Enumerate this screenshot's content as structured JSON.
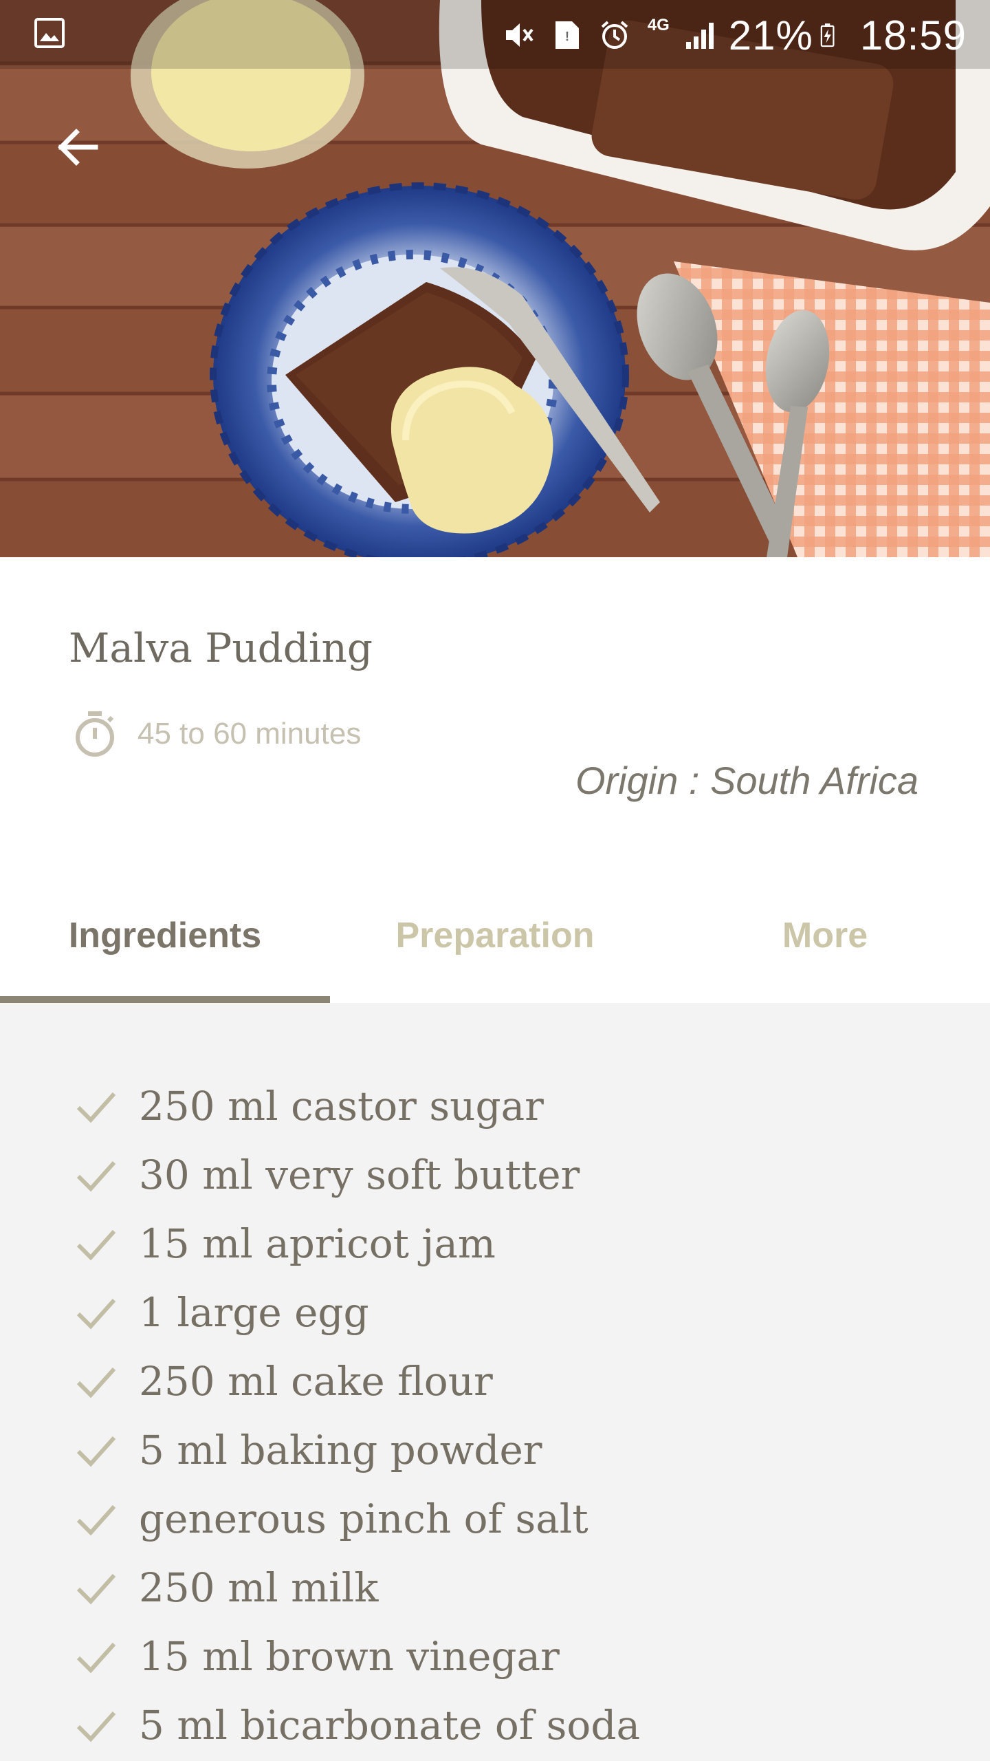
{
  "status_bar": {
    "network": "4G",
    "battery": "21%",
    "time": "18:59"
  },
  "recipe": {
    "title": "Malva Pudding",
    "duration": "45 to 60 minutes",
    "origin": "Origin : South Africa"
  },
  "tabs": [
    {
      "label": "Ingredients",
      "active": true
    },
    {
      "label": "Preparation",
      "active": false
    },
    {
      "label": "More",
      "active": false
    }
  ],
  "ingredients": [
    "250 ml castor sugar",
    "30 ml very soft butter",
    "15 ml apricot jam",
    "1 large egg",
    "250 ml cake flour",
    "5 ml baking powder",
    "generous pinch of salt",
    "250 ml milk",
    "15 ml brown vinegar",
    "5 ml bicarbonate of soda"
  ],
  "colors": {
    "accent": "#8a8575",
    "tab_inactive": "#ccc6a9",
    "check": "#c2bda5",
    "text": "#767064"
  },
  "icons": {
    "gallery": "gallery-icon",
    "back": "arrow-left-icon",
    "timer": "stopwatch-icon",
    "check": "check-icon"
  }
}
